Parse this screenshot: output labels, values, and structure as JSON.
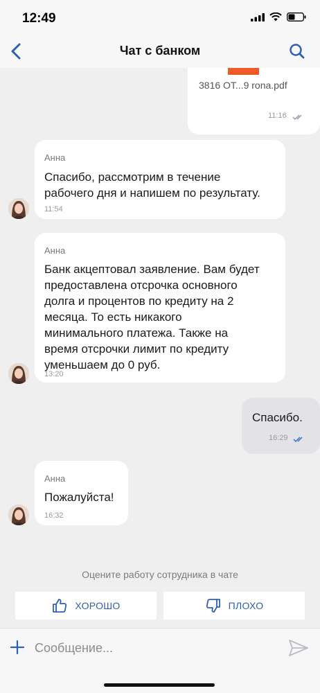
{
  "status_bar": {
    "time": "12:49"
  },
  "header": {
    "title": "Чат с банком"
  },
  "messages": [
    {
      "direction": "out",
      "attachment_name": "3816 OT...9 rona.pdf",
      "time": "11:16"
    },
    {
      "direction": "in",
      "sender": "Анна",
      "lines": [
        "Спасибо, рассмотрим в течение",
        "рабочего дня и напишем по результату."
      ],
      "time": "11:54"
    },
    {
      "direction": "in",
      "sender": "Анна",
      "lines": [
        "Банк акцептовал заявление. Вам будет",
        "предоставлена отсрочка основного",
        "долга и процентов по кредиту на 2",
        "месяца. То есть никакого",
        "минимального платежа. Также на",
        "время отсрочки лимит по кредиту",
        "уменьшаем до 0 руб."
      ],
      "time": "13:20"
    },
    {
      "direction": "out",
      "text": "Спасибо.",
      "time": "16:29"
    },
    {
      "direction": "in",
      "sender": "Анна",
      "text": "Пожалуйста!",
      "time": "16:32"
    }
  ],
  "rating": {
    "prompt": "Оцените работу сотрудника в чате",
    "good_label": "ХОРОШО",
    "bad_label": "ПЛОХО"
  },
  "input": {
    "placeholder": "Сообщение...",
    "value": ""
  },
  "colors": {
    "accent": "#2f5fb1",
    "attachment_bar": "#f05a28",
    "read_check": "#4a78c8"
  },
  "icons": [
    "back-arrow-icon",
    "search-icon",
    "double-check-icon",
    "thumbs-up-icon",
    "thumbs-down-icon",
    "plus-icon",
    "send-icon"
  ]
}
